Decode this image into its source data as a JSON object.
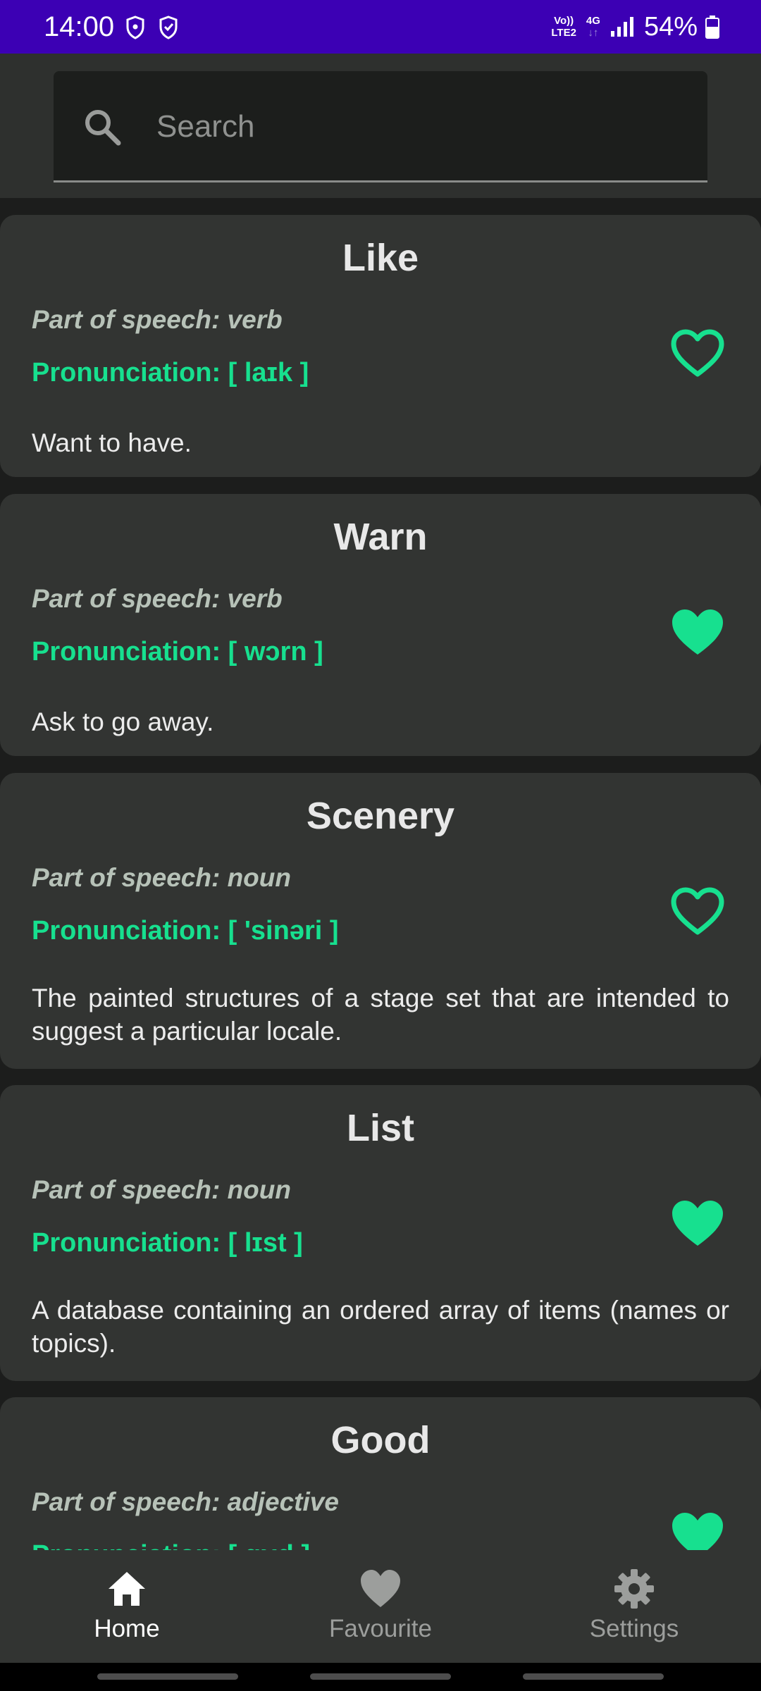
{
  "status_bar": {
    "time": "14:00",
    "volte_line1": "Vo))",
    "volte_line2": "LTE2",
    "network_line1": "4G",
    "network_line2": "↓↑",
    "battery": "54%"
  },
  "search": {
    "placeholder": "Search",
    "icon": "search-icon"
  },
  "words": [
    {
      "word": "Like",
      "part_of_speech": "Part of speech: verb",
      "pronunciation": "Pronunciation: [ laɪk ]",
      "definition": "Want to have.",
      "favourite": false
    },
    {
      "word": "Warn",
      "part_of_speech": "Part of speech: verb",
      "pronunciation": "Pronunciation: [ wɔrn ]",
      "definition": "Ask to go away.",
      "favourite": true
    },
    {
      "word": "Scenery",
      "part_of_speech": "Part of speech: noun",
      "pronunciation": "Pronunciation: [ 'sinəri ]",
      "definition": "The painted structures of a stage set that are intended to suggest a particular locale.",
      "favourite": false
    },
    {
      "word": "List",
      "part_of_speech": "Part of speech: noun",
      "pronunciation": "Pronunciation: [ lɪst ]",
      "definition": "A database containing an ordered array of items (names or topics).",
      "favourite": true
    },
    {
      "word": "Good",
      "part_of_speech": "Part of speech: adjective",
      "pronunciation": "Pronunciation: [ gʊd ]",
      "definition": "",
      "favourite": true
    }
  ],
  "nav": {
    "home": "Home",
    "favourite": "Favourite",
    "settings": "Settings",
    "active": "home"
  },
  "colors": {
    "accent": "#17e08f",
    "status_bar": "#3c00b4",
    "card": "#323432"
  }
}
